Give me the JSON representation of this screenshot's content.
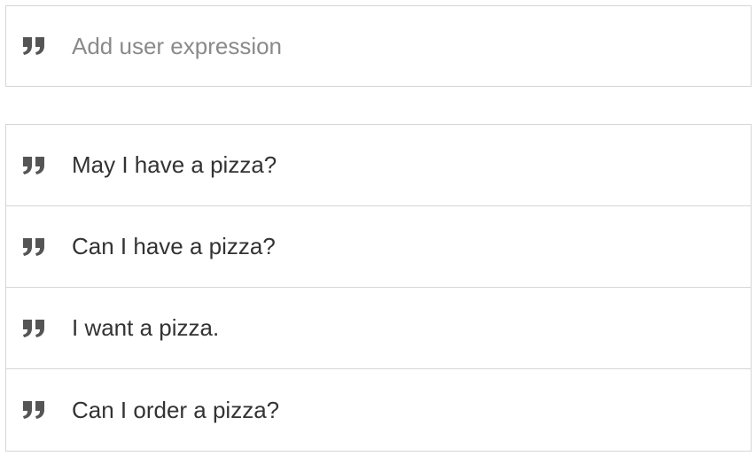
{
  "add_expression": {
    "placeholder": "Add user expression",
    "value": "",
    "icon": "quote-icon"
  },
  "expressions": [
    {
      "text": "May I have a pizza?",
      "icon": "quote-icon"
    },
    {
      "text": "Can I have a pizza?",
      "icon": "quote-icon"
    },
    {
      "text": "I want a pizza.",
      "icon": "quote-icon"
    },
    {
      "text": "Can I order a pizza?",
      "icon": "quote-icon"
    }
  ],
  "colors": {
    "border": "#d6d6d6",
    "icon": "#555555",
    "text": "#333333",
    "placeholder": "#8a8a8a"
  }
}
